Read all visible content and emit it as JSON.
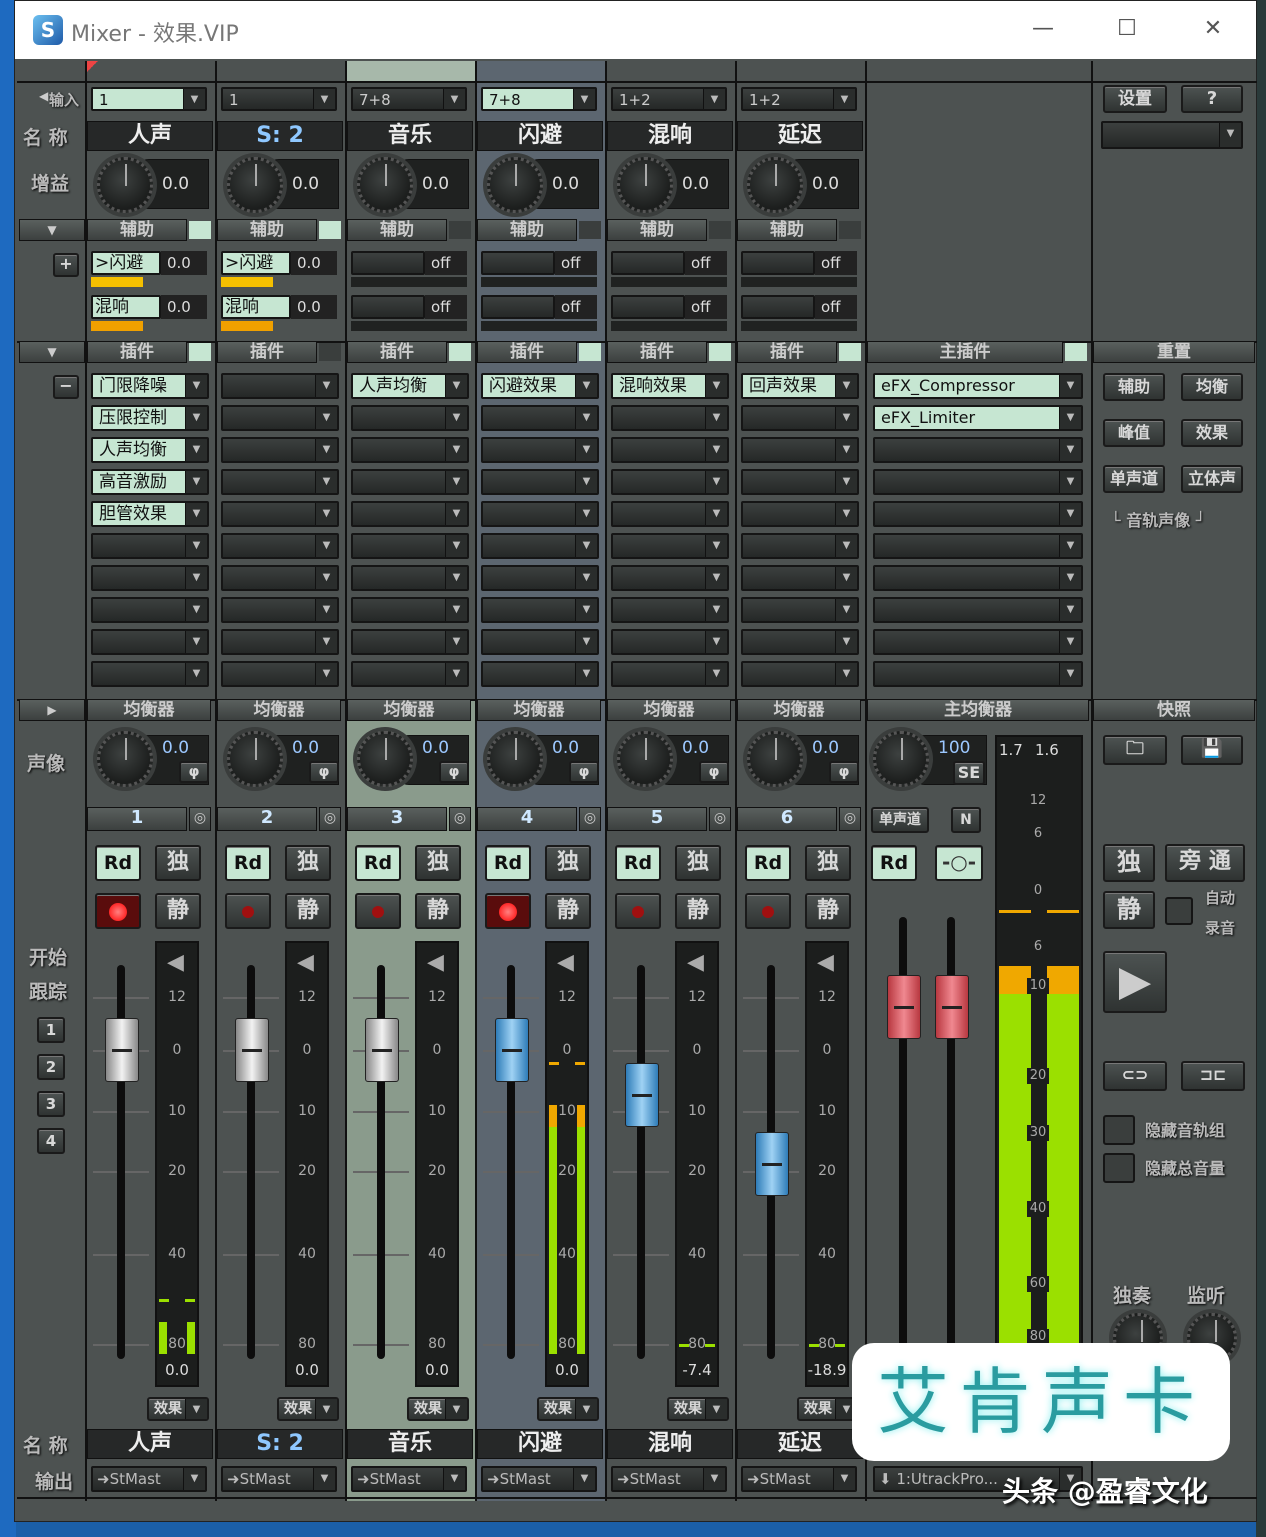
{
  "window": {
    "title": "Mixer - 效果.VIP",
    "app_icon": "S",
    "minimize": "—",
    "maximize": "☐",
    "close": "✕"
  },
  "labels": {
    "input": "输入",
    "name": "名 称",
    "gain": "增益",
    "pan": "声像",
    "start": "开始",
    "track": "跟踪",
    "name_bottom": "名 称",
    "output": "输出",
    "track_buttons": [
      "1",
      "2",
      "3",
      "4"
    ],
    "add": "+",
    "remove": "−"
  },
  "sections": {
    "aux": "辅助",
    "plugins": "插件",
    "eq": "均衡器",
    "fx": "效果",
    "master_plugins": "主插件",
    "master_eq": "主均衡器",
    "reset": "重置",
    "snapshot": "快照",
    "off": "off",
    "rd": "Rd",
    "solo": "独",
    "mute": "静"
  },
  "meter_scale": [
    "12",
    "0",
    "10",
    "20",
    "40",
    "80"
  ],
  "colors": {
    "accent_green": "#c6e6d2",
    "meter_green": "#9be000",
    "meter_orange": "#f0a800",
    "rec_red": "#ff2020",
    "ch3_bg": "#8a9b8c",
    "ch4_bg": "#5c6670"
  },
  "channels": [
    {
      "input": "1",
      "input_on": true,
      "name": "人声",
      "gain": "0.0",
      "aux": [
        {
          "label": ">闪避",
          "value": "0.0",
          "level": 0.45,
          "color": "#f5c000"
        },
        {
          "label": "混响",
          "value": "0.0",
          "level": 0.45,
          "color": "#f0a000"
        }
      ],
      "plugins": [
        "门限降噪",
        "压限控制",
        "人声均衡",
        "高音激励",
        "胆管效果"
      ],
      "pan": "0.0",
      "number": "1",
      "rec_armed": true,
      "fader_db": 0,
      "readout": "0.0",
      "meter_db": -70,
      "peak_db": -60,
      "output": "StMast"
    },
    {
      "input": "1",
      "input_on": false,
      "name": "S: 2",
      "gain": "0.0",
      "aux": [
        {
          "label": ">闪避",
          "value": "0.0",
          "level": 0.45,
          "color": "#f5c000"
        },
        {
          "label": "混响",
          "value": "0.0",
          "level": 0.45,
          "color": "#f0a000"
        }
      ],
      "plugins": [],
      "pan": "0.0",
      "number": "2",
      "rec_armed": false,
      "fader_db": 0,
      "readout": "0.0",
      "meter_db": null,
      "peak_db": null,
      "output": "StMast"
    },
    {
      "input": "7+8",
      "input_on": false,
      "name": "音乐",
      "gain": "0.0",
      "aux": [],
      "plugins": [
        "人声均衡"
      ],
      "pan": "0.0",
      "number": "3",
      "rec_armed": false,
      "fader_db": 0,
      "readout": "0.0",
      "meter_db": null,
      "peak_db": null,
      "output": "StMast"
    },
    {
      "input": "7+8",
      "input_on": true,
      "name": "闪避",
      "gain": "0.0",
      "aux": [],
      "plugins": [
        "闪避效果"
      ],
      "pan": "0.0",
      "number": "4",
      "rec_armed": true,
      "fader_db": 0,
      "readout": "0.0",
      "meter_db": -9,
      "peak_db": -2,
      "output": "StMast"
    },
    {
      "input": "1+2",
      "input_on": false,
      "name": "混响",
      "gain": "0.0",
      "aux": [],
      "plugins": [
        "混响效果"
      ],
      "pan": "0.0",
      "number": "5",
      "rec_armed": false,
      "fader_db": -7.4,
      "readout": "-7.4",
      "meter_db": null,
      "peak_db": -80,
      "output": "StMast"
    },
    {
      "input": "1+2",
      "input_on": false,
      "name": "延迟",
      "gain": "0.0",
      "aux": [],
      "plugins": [
        "回声效果"
      ],
      "pan": "0.0",
      "number": "6",
      "rec_armed": false,
      "fader_db": -18.9,
      "readout": "-18.9",
      "meter_db": null,
      "peak_db": -80,
      "output": "StMast"
    }
  ],
  "master": {
    "plugins": [
      "eFX_Compressor",
      "eFX_Limiter"
    ],
    "width": "100",
    "se": "SE",
    "mono": "单声道",
    "n": "N",
    "rd": "Rd",
    "peak_l": "1.7",
    "peak_r": "1.6",
    "scale": [
      "12",
      "6",
      "0",
      "6",
      "10",
      "20",
      "30",
      "40",
      "60",
      "80"
    ],
    "level_db": -10,
    "peak_db": -2,
    "output": "1:UtrackPro..."
  },
  "right": {
    "settings": "设置",
    "help": "?",
    "reset_buttons": [
      "辅助",
      "均衡",
      "峰值",
      "效果",
      "单声道",
      "立体声"
    ],
    "track_pan": "└ 音轨声像 ┘",
    "solo": "独",
    "bypass": "旁 通",
    "mute": "静",
    "auto_record_1": "自动",
    "auto_record_2": "录音",
    "hide_groups": "隐藏音轨组",
    "hide_master": "隐藏总音量",
    "solo_knob": "独奏",
    "monitor_knob": "监听"
  },
  "watermark": {
    "brand": "艾肯声卡",
    "credit": "头条 @盈睿文化"
  }
}
